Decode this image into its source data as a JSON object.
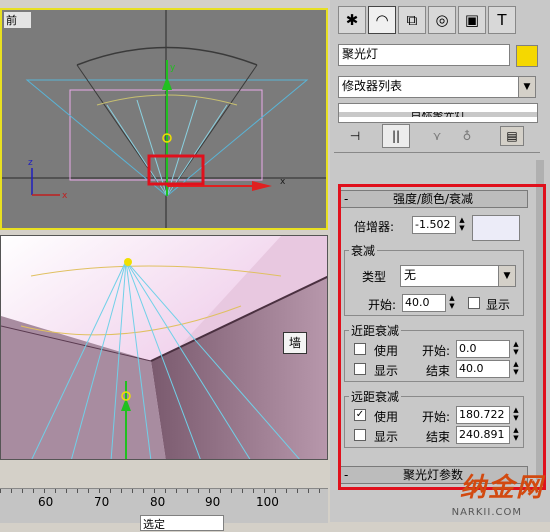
{
  "viewports": {
    "front_label": "前",
    "persp_label": "",
    "wall_tag": "墙",
    "axis_z": "z",
    "axis_x": "x",
    "axis_y": "y"
  },
  "tabs": [
    "create-icon",
    "modify-icon",
    "hierarchy-icon",
    "motion-icon",
    "display-icon",
    "utilities-icon"
  ],
  "object_name": "聚光灯",
  "object_color": "#f5d800",
  "modifier_list": "修改器列表",
  "collapsed_rollout_above": "目标聚光灯",
  "stack_buttons": [
    "pin-stack-icon",
    "show-end-result-icon",
    "make-unique-icon",
    "remove-modifier-icon",
    "configure-sets-icon"
  ],
  "rollout": {
    "title": "强度/颜色/衰减",
    "multiplier_label": "倍增器:",
    "multiplier_value": "-1.502",
    "multiplier_color": "#ececf8",
    "decay": {
      "title": "衰减",
      "type_label": "类型",
      "type_value": "无",
      "start_label": "开始:",
      "start_value": "40.0",
      "show_label": "显示"
    },
    "near": {
      "title": "近距衰减",
      "use_label": "使用",
      "show_label": "显示",
      "start_label": "开始:",
      "start_value": "0.0",
      "end_label": "结束",
      "end_value": "40.0"
    },
    "far": {
      "title": "远距衰减",
      "use_label": "使用",
      "use_checked": "✓",
      "show_label": "显示",
      "start_label": "开始:",
      "start_value": "180.722",
      "end_label": "结束",
      "end_value": "240.891"
    }
  },
  "next_rollout": "聚光灯参数",
  "ruler_ticks": [
    "60",
    "70",
    "80",
    "90",
    "100"
  ],
  "status": {
    "bottom_field": "选定"
  },
  "watermark": {
    "main": "纳金网",
    "sub": "NARKII.COM"
  },
  "highlight_color": "#e0101c"
}
